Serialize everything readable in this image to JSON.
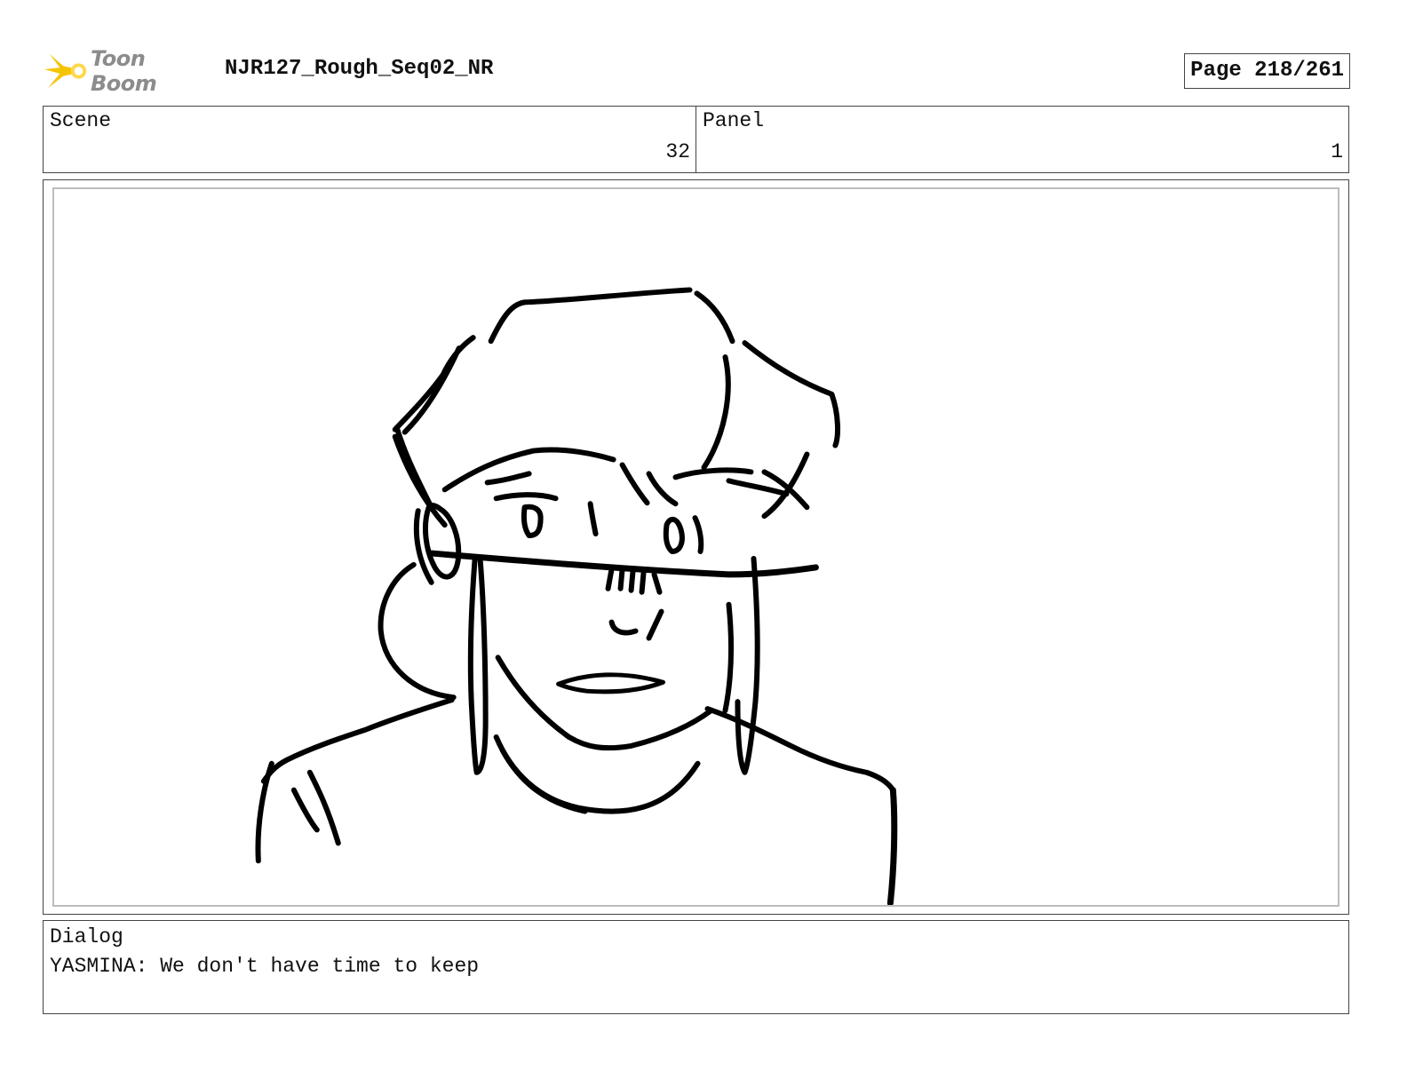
{
  "header": {
    "logo_text": "Toon Boom",
    "project_title": "NJR127_Rough_Seq02_NR",
    "page_label": "Page 218/261"
  },
  "info": {
    "scene_label": "Scene",
    "scene_value": "32",
    "panel_label": "Panel",
    "panel_value": "1"
  },
  "dialog": {
    "label": "Dialog",
    "text": "YASMINA: We don't have time to keep"
  },
  "colors": {
    "logo_accent": "#f5c400",
    "logo_text": "#8c8c8c",
    "border": "#444444",
    "inner_frame": "#bdbdbd"
  }
}
